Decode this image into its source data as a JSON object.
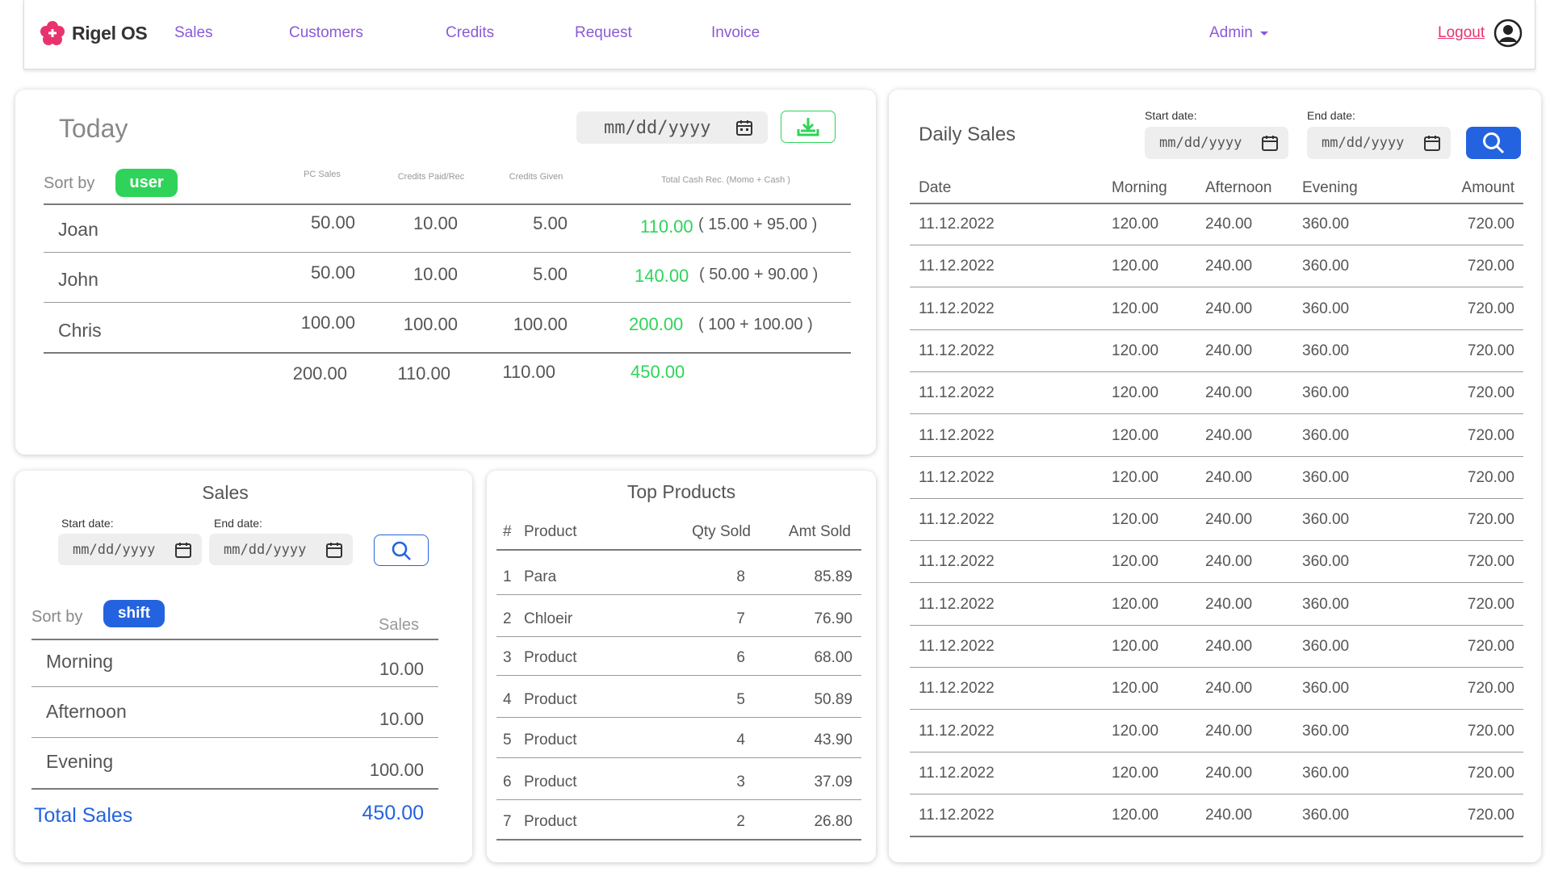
{
  "nav": {
    "brand": "Rigel OS",
    "links": [
      "Sales",
      "Customers",
      "Credits",
      "Request",
      "Invoice"
    ],
    "admin": "Admin",
    "logout": "Logout"
  },
  "colors": {
    "accent_purple": "#8a5ad6",
    "green": "#2fd35a",
    "blue": "#2463e0",
    "pink": "#e8336e"
  },
  "today": {
    "title": "Today",
    "date_placeholder": "mm/dd/yyyy",
    "sort_label": "Sort by",
    "sort_value": "user",
    "columns": [
      "PC Sales",
      "Credits Paid/Rec",
      "Credits Given",
      "Total Cash Rec. (Momo + Cash )"
    ],
    "rows": [
      {
        "name": "Joan",
        "pc": "50.00",
        "paid": "10.00",
        "given": "5.00",
        "total": "110.00",
        "breakdown": "( 15.00 + 95.00 )"
      },
      {
        "name": "John",
        "pc": "50.00",
        "paid": "10.00",
        "given": "5.00",
        "total": "140.00",
        "breakdown": "( 50.00 + 90.00 )"
      },
      {
        "name": "Chris",
        "pc": "100.00",
        "paid": "100.00",
        "given": "100.00",
        "total": "200.00",
        "breakdown": "( 100 + 100.00 )"
      }
    ],
    "totals": {
      "pc": "200.00",
      "paid": "110.00",
      "given": "110.00",
      "total": "450.00"
    }
  },
  "sales": {
    "title": "Sales",
    "start_label": "Start date:",
    "end_label": "End date:",
    "date_placeholder": "mm/dd/yyyy",
    "sort_label": "Sort by",
    "sort_value": "shift",
    "column": "Sales",
    "rows": [
      {
        "name": "Morning",
        "value": "10.00"
      },
      {
        "name": "Afternoon",
        "value": "10.00"
      },
      {
        "name": "Evening",
        "value": "100.00"
      }
    ],
    "total_label": "Total Sales",
    "total_value": "450.00"
  },
  "top_products": {
    "title": "Top Products",
    "columns": [
      "#",
      "Product",
      "Qty Sold",
      "Amt Sold"
    ],
    "rows": [
      {
        "n": "1",
        "product": "Para",
        "qty": "8",
        "amt": "85.89"
      },
      {
        "n": "2",
        "product": "Chloeir",
        "qty": "7",
        "amt": "76.90"
      },
      {
        "n": "3",
        "product": "Product",
        "qty": "6",
        "amt": "68.00"
      },
      {
        "n": "4",
        "product": "Product",
        "qty": "5",
        "amt": "50.89"
      },
      {
        "n": "5",
        "product": "Product",
        "qty": "4",
        "amt": "43.90"
      },
      {
        "n": "6",
        "product": "Product",
        "qty": "3",
        "amt": "37.09"
      },
      {
        "n": "7",
        "product": "Product",
        "qty": "2",
        "amt": "26.80"
      }
    ]
  },
  "daily_sales": {
    "title": "Daily Sales",
    "start_label": "Start date:",
    "end_label": "End date:",
    "date_placeholder": "mm/dd/yyyy",
    "columns": [
      "Date",
      "Morning",
      "Afternoon",
      "Evening",
      "Amount"
    ],
    "rows": [
      [
        "11.12.2022",
        "120.00",
        "240.00",
        "360.00",
        "720.00"
      ],
      [
        "11.12.2022",
        "120.00",
        "240.00",
        "360.00",
        "720.00"
      ],
      [
        "11.12.2022",
        "120.00",
        "240.00",
        "360.00",
        "720.00"
      ],
      [
        "11.12.2022",
        "120.00",
        "240.00",
        "360.00",
        "720.00"
      ],
      [
        "11.12.2022",
        "120.00",
        "240.00",
        "360.00",
        "720.00"
      ],
      [
        "11.12.2022",
        "120.00",
        "240.00",
        "360.00",
        "720.00"
      ],
      [
        "11.12.2022",
        "120.00",
        "240.00",
        "360.00",
        "720.00"
      ],
      [
        "11.12.2022",
        "120.00",
        "240.00",
        "360.00",
        "720.00"
      ],
      [
        "11.12.2022",
        "120.00",
        "240.00",
        "360.00",
        "720.00"
      ],
      [
        "11.12.2022",
        "120.00",
        "240.00",
        "360.00",
        "720.00"
      ],
      [
        "11.12.2022",
        "120.00",
        "240.00",
        "360.00",
        "720.00"
      ],
      [
        "11.12.2022",
        "120.00",
        "240.00",
        "360.00",
        "720.00"
      ],
      [
        "11.12.2022",
        "120.00",
        "240.00",
        "360.00",
        "720.00"
      ],
      [
        "11.12.2022",
        "120.00",
        "240.00",
        "360.00",
        "720.00"
      ],
      [
        "11.12.2022",
        "120.00",
        "240.00",
        "360.00",
        "720.00"
      ]
    ]
  }
}
